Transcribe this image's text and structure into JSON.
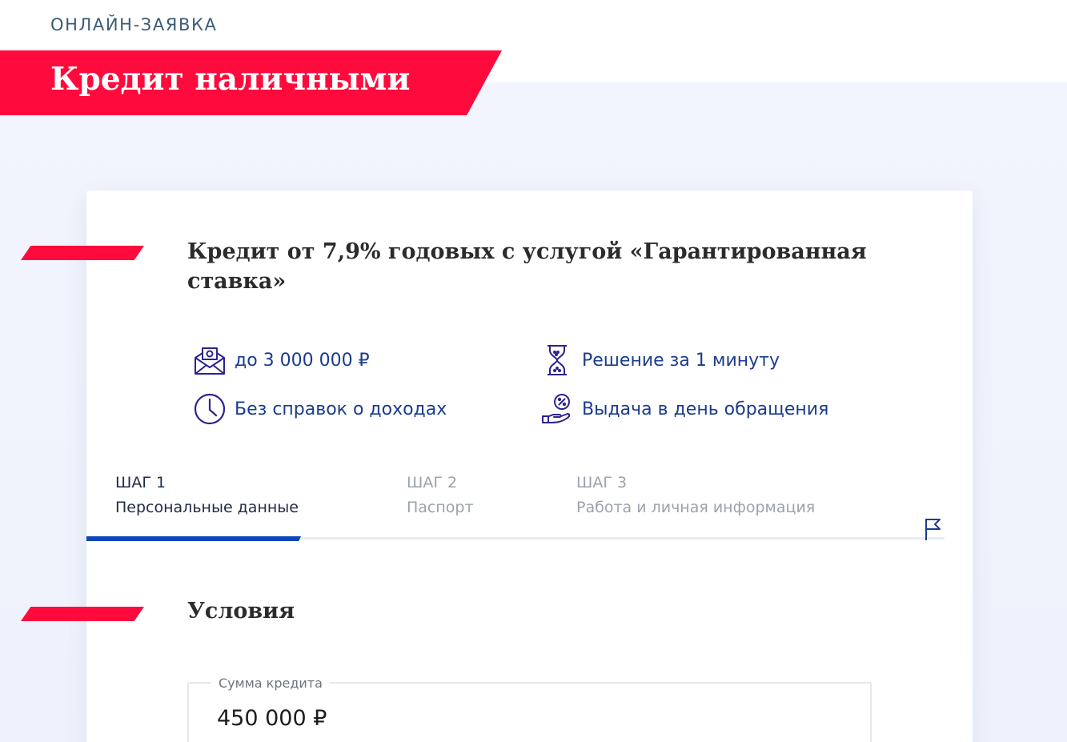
{
  "header": {
    "breadcrumb": "ОНЛАЙН-ЗАЯВКА",
    "title": "Кредит наличными"
  },
  "offer": {
    "heading": "Кредит от 7,9% годовых с услугой «Гарантированная ставка»",
    "features": [
      {
        "icon": "envelope-money-icon",
        "text": "до 3 000 000 ₽"
      },
      {
        "icon": "hourglass-icon",
        "text": "Решение за 1 минуту"
      },
      {
        "icon": "clock-icon",
        "text": "Без справок о доходах"
      },
      {
        "icon": "hand-percent-icon",
        "text": "Выдача в день обращения"
      }
    ]
  },
  "steps": {
    "items": [
      {
        "num": "ШАГ 1",
        "label": "Персональные данные",
        "state": "active"
      },
      {
        "num": "ШАГ 2",
        "label": "Паспорт",
        "state": "inactive"
      },
      {
        "num": "ШАГ 3",
        "label": "Работа и личная информация",
        "state": "inactive"
      }
    ],
    "progress_fraction": 0.25
  },
  "conditions": {
    "heading": "Условия",
    "amount_label": "Сумма кредита",
    "amount_value": "450 000 ₽"
  },
  "colors": {
    "brand_red": "#ff0a3c",
    "accent_blue": "#0c47b8",
    "link_blue": "#1b3c8c",
    "background": "#f2f5fd"
  }
}
